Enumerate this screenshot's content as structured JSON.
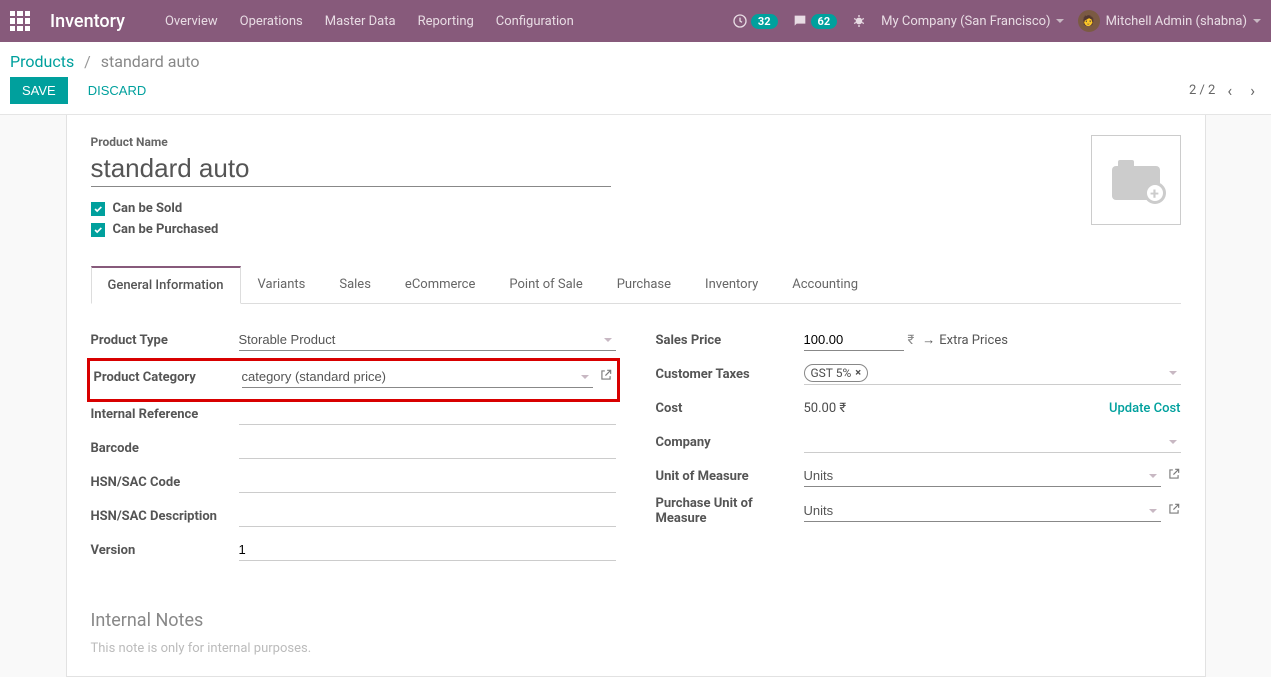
{
  "navbar": {
    "title": "Inventory",
    "menu": [
      "Overview",
      "Operations",
      "Master Data",
      "Reporting",
      "Configuration"
    ],
    "activities_count": "32",
    "messages_count": "62",
    "company": "My Company (San Francisco)",
    "user": "Mitchell Admin (shabna)"
  },
  "breadcrumb": {
    "parent": "Products",
    "current": "standard auto"
  },
  "buttons": {
    "save": "SAVE",
    "discard": "DISCARD"
  },
  "pager": {
    "position": "2 / 2"
  },
  "product": {
    "name_label": "Product Name",
    "name_value": "standard auto",
    "can_be_sold": "Can be Sold",
    "can_be_purchased": "Can be Purchased"
  },
  "tabs": [
    "General Information",
    "Variants",
    "Sales",
    "eCommerce",
    "Point of Sale",
    "Purchase",
    "Inventory",
    "Accounting"
  ],
  "left_fields": {
    "product_type": {
      "label": "Product Type",
      "value": "Storable Product"
    },
    "product_category": {
      "label": "Product Category",
      "value": "category (standard price)"
    },
    "internal_reference": {
      "label": "Internal Reference",
      "value": ""
    },
    "barcode": {
      "label": "Barcode",
      "value": ""
    },
    "hsn_code": {
      "label": "HSN/SAC Code",
      "value": ""
    },
    "hsn_desc": {
      "label": "HSN/SAC Description",
      "value": ""
    },
    "version": {
      "label": "Version",
      "value": "1"
    }
  },
  "right_fields": {
    "sales_price": {
      "label": "Sales Price",
      "value": "100.00",
      "currency": "₹",
      "extra": "Extra Prices"
    },
    "customer_taxes": {
      "label": "Customer Taxes",
      "tag": "GST 5%"
    },
    "cost": {
      "label": "Cost",
      "value": "50.00 ₹",
      "action": "Update Cost"
    },
    "company": {
      "label": "Company",
      "value": ""
    },
    "uom": {
      "label": "Unit of Measure",
      "value": "Units"
    },
    "purchase_uom": {
      "label": "Purchase Unit of Measure",
      "value": "Units"
    }
  },
  "notes": {
    "title": "Internal Notes",
    "placeholder": "This note is only for internal purposes."
  }
}
